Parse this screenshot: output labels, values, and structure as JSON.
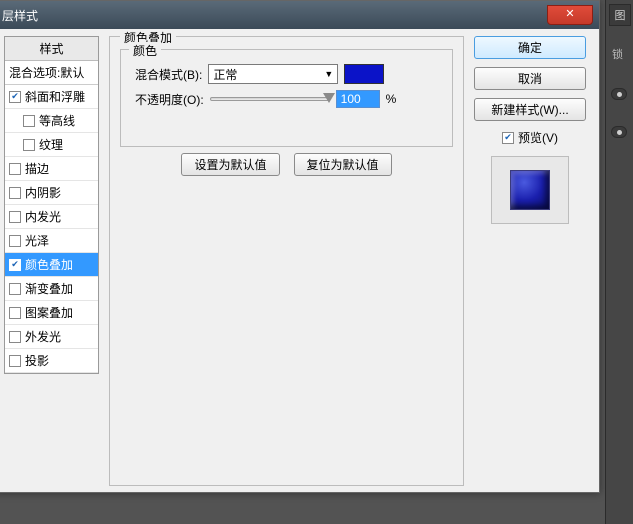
{
  "title": "层样式",
  "styles_header": "样式",
  "styles_sub": "混合选项:默认",
  "styles": [
    {
      "label": "斜面和浮雕",
      "checked": true
    },
    {
      "label": "等高线",
      "checked": false,
      "child": true
    },
    {
      "label": "纹理",
      "checked": false,
      "child": true
    },
    {
      "label": "描边",
      "checked": false
    },
    {
      "label": "内阴影",
      "checked": false
    },
    {
      "label": "内发光",
      "checked": false
    },
    {
      "label": "光泽",
      "checked": false
    },
    {
      "label": "颜色叠加",
      "checked": true,
      "selected": true
    },
    {
      "label": "渐变叠加",
      "checked": false
    },
    {
      "label": "图案叠加",
      "checked": false
    },
    {
      "label": "外发光",
      "checked": false
    },
    {
      "label": "投影",
      "checked": false
    }
  ],
  "panel": {
    "title": "颜色叠加",
    "inner_title": "颜色",
    "blend_label": "混合模式(B):",
    "blend_value": "正常",
    "opacity_label": "不透明度(O):",
    "opacity_value": "100",
    "opacity_unit": "%",
    "swatch_color": "#0b13c8",
    "set_default": "设置为默认值",
    "reset_default": "复位为默认值"
  },
  "right": {
    "ok": "确定",
    "cancel": "取消",
    "new_style": "新建样式(W)...",
    "preview": "预览(V)"
  },
  "strip": {
    "tab": "图",
    "lock": "锁"
  }
}
